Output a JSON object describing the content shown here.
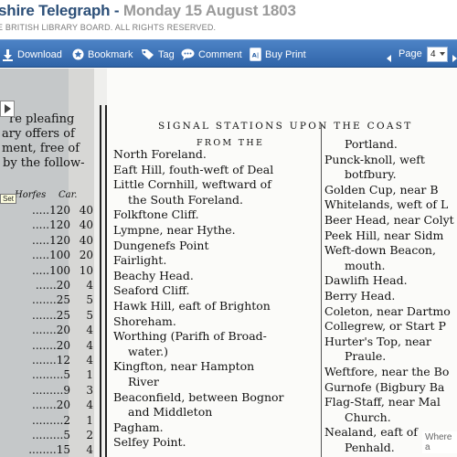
{
  "header": {
    "publication": "shire Telegraph",
    "separator": " - ",
    "date": "Monday 15 August 1803",
    "copyright": "E BRITISH LIBRARY BOARD. ALL RIGHTS RESERVED."
  },
  "toolbar": {
    "download": "Download",
    "bookmark": "Bookmark",
    "tag": "Tag",
    "comment": "Comment",
    "buy_print": "Buy Print",
    "page_label": "Page",
    "page_value": "4",
    "icons": [
      "download-icon",
      "bookmark-icon",
      "tag-icon",
      "comment-icon",
      "pdf-icon",
      "prev-page-icon",
      "next-page-icon"
    ]
  },
  "viewer": {
    "play_icon": "play-icon",
    "tooltip": "Set",
    "hover_hint": "Where a",
    "left_column": {
      "lines": [
        "re pleafing",
        "ary offers of",
        "ment, free of",
        "by the follow-"
      ],
      "headers": [
        "Horfes",
        "Car."
      ],
      "rows": [
        [
          ".....120",
          "40"
        ],
        [
          ".....120",
          "40"
        ],
        [
          ".....120",
          "40"
        ],
        [
          ".....100",
          "20"
        ],
        [
          ".....100",
          "10"
        ],
        [
          "......20",
          "4"
        ],
        [
          ".......25",
          "5"
        ],
        [
          ".......25",
          "5"
        ],
        [
          ".......20",
          "4"
        ],
        [
          ".......20",
          "4"
        ],
        [
          ".......12",
          "4"
        ],
        [
          ".........5",
          "1"
        ],
        [
          ".........9",
          "3"
        ],
        [
          ".......20",
          "4"
        ],
        [
          ".........2",
          "1"
        ],
        [
          ".........5",
          "2"
        ],
        [
          "........15",
          "4"
        ]
      ]
    },
    "main_column": {
      "heading": "SIGNAL STATIONS UPON THE COAST",
      "subheading": "FROM THE",
      "stations_left": [
        "North Foreland.",
        "Eaft Hill, fouth-weft of Deal",
        "Little Cornhill, weftward of",
        "the South Foreland.",
        "Folkftone Cliff.",
        "Lympne, near Hythe.",
        "Dungenefs Point",
        "Fairlight.",
        "Beachy Head.",
        "Seaford Cliff.",
        "Hawk Hill, eaft of Brighton",
        "Shoreham.",
        "Worthing (Parifh of Broad-",
        "water.)",
        "Kingfton, near Hampton",
        "River",
        "Beaconfield, between Bognor",
        "and Middleton",
        "Pagham.",
        "Selfey Point."
      ],
      "stations_right": [
        "Portland.",
        "Punck-knoll, weft",
        "botfbury.",
        "Golden Cup, near B",
        "Whitelands, weft of L",
        "Beer Head, near Colyt",
        "Peek Hill, near Sidm",
        "Weft-down Beacon,",
        "mouth.",
        "Dawlifh Head.",
        "Berry Head.",
        "Coleton, near Dartmo",
        "Collegrew, or Start P",
        "Hurter's Top, near",
        "Praule.",
        "Weftfore, near the Bo",
        "Gurnofe (Bigbury Ba",
        "Flag-Staff, near Mal",
        "Church.",
        "Nealand, eaft of",
        "Penhald."
      ]
    }
  },
  "colors": {
    "brand_title": "#2c4f78",
    "date_grey": "#9a9a9a",
    "toolbar_blue": "#3a6fb3"
  }
}
